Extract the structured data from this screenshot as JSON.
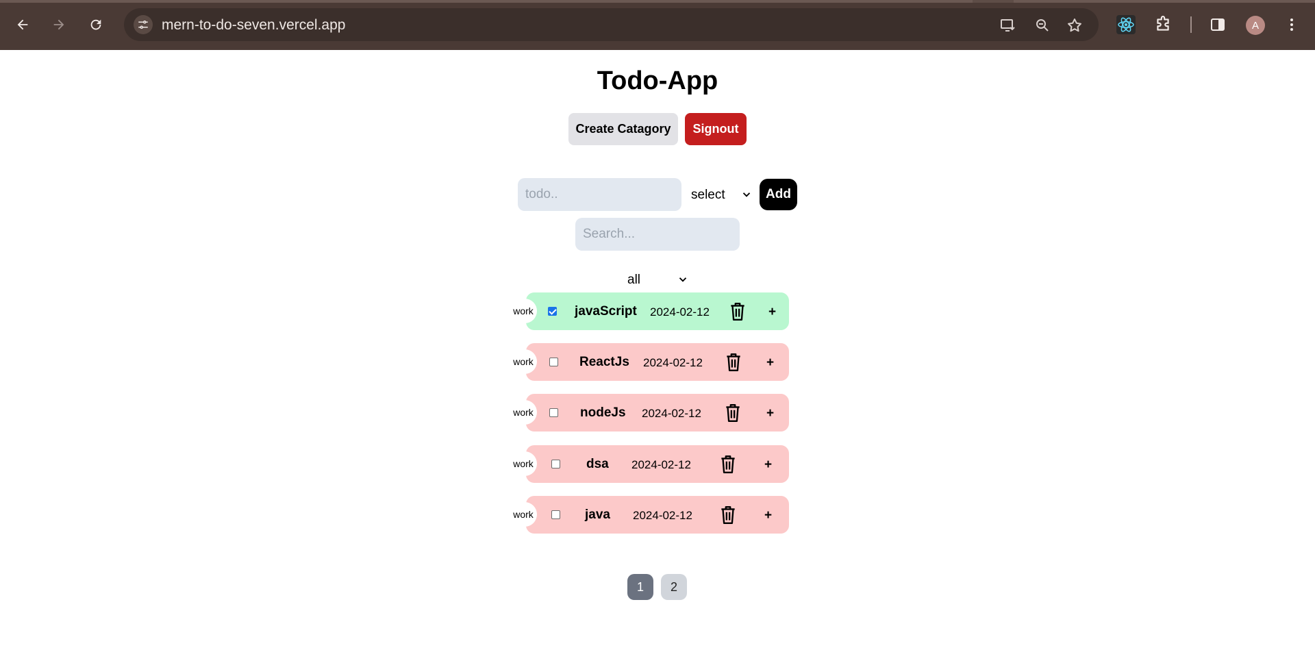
{
  "browser": {
    "url": "mern-to-do-seven.vercel.app",
    "profile_initial": "A",
    "icons": [
      "back-arrow-icon",
      "forward-arrow-icon",
      "reload-icon",
      "site-info-icon",
      "install-app-icon",
      "zoom-icon",
      "bookmark-star-icon",
      "react-devtools-icon",
      "extensions-icon",
      "side-panel-icon",
      "menu-dots-icon"
    ]
  },
  "app": {
    "title": "Todo-App",
    "create_category_label": "Create Catagory",
    "signout_label": "Signout",
    "todo_placeholder": "todo..",
    "category_select": "select",
    "add_label": "Add",
    "search_placeholder": "Search...",
    "filter_select": "all"
  },
  "todos": [
    {
      "category": "work",
      "title": "javaScript",
      "date": "2024-02-12",
      "completed": true
    },
    {
      "category": "work",
      "title": "ReactJs",
      "date": "2024-02-12",
      "completed": false
    },
    {
      "category": "work",
      "title": "nodeJs",
      "date": "2024-02-12",
      "completed": false
    },
    {
      "category": "work",
      "title": "dsa",
      "date": "2024-02-12",
      "completed": false
    },
    {
      "category": "work",
      "title": "java",
      "date": "2024-02-12",
      "completed": false
    }
  ],
  "pagination": {
    "pages": [
      "1",
      "2"
    ],
    "current": "1"
  },
  "colors": {
    "completed_row": "#b9f7d0",
    "pending_row": "#fcc9c9",
    "signout": "#c41e1e",
    "add": "#000000"
  }
}
